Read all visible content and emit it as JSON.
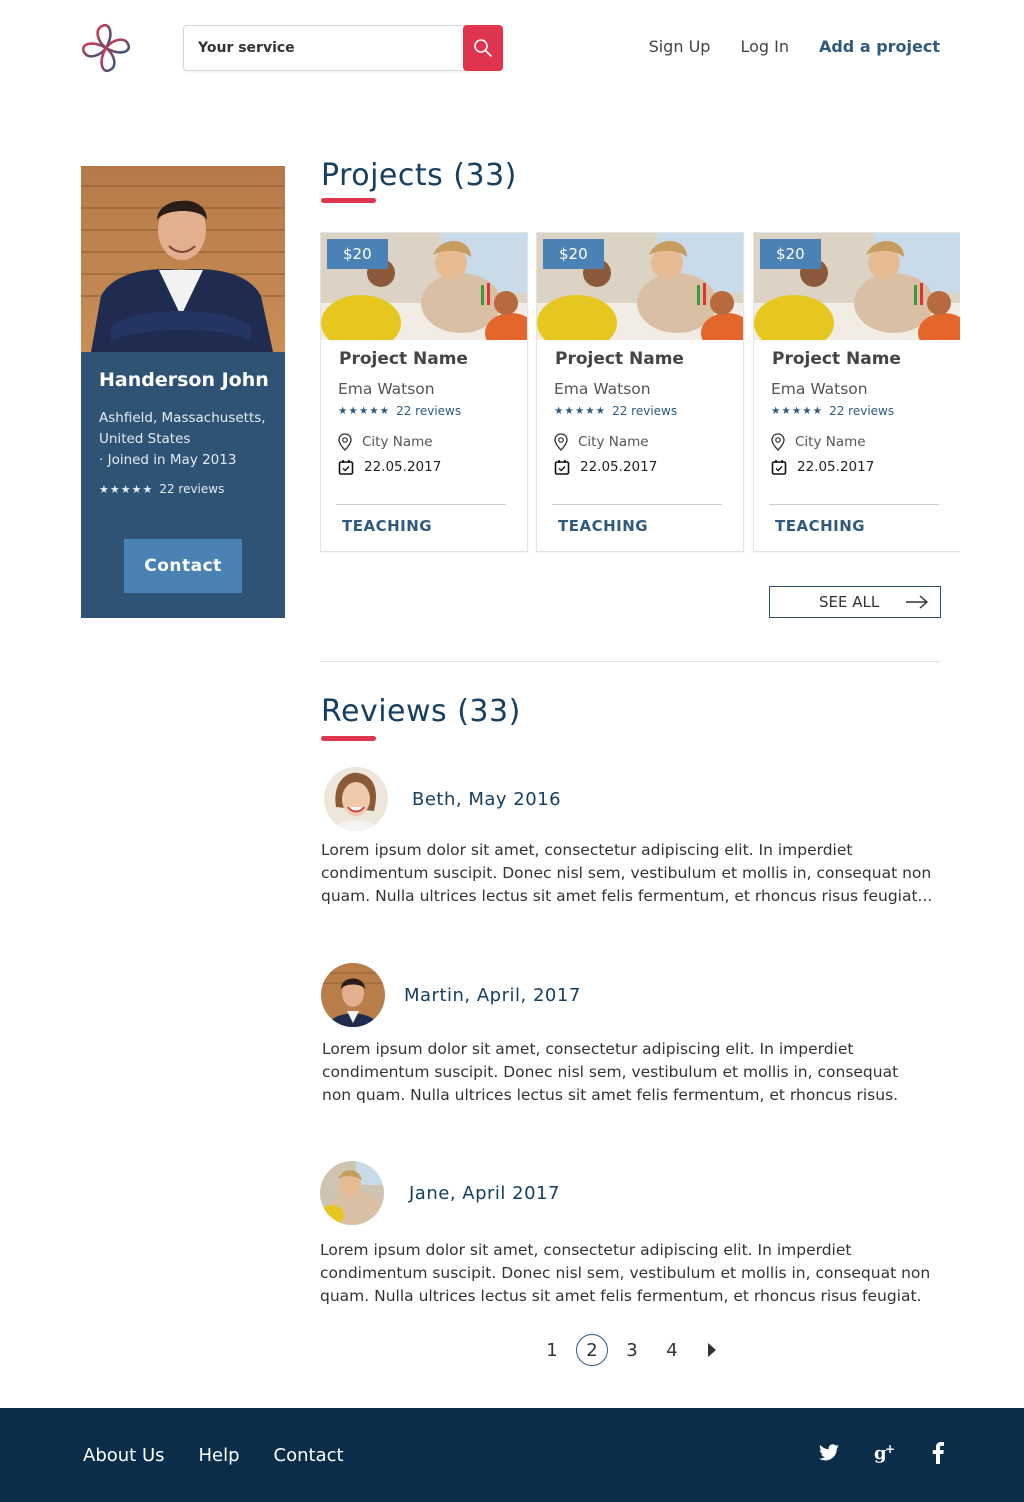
{
  "header": {
    "search_placeholder": "Your service",
    "nav": [
      "Sign Up",
      "Log In",
      "Add a project"
    ]
  },
  "profile": {
    "name": "Handerson John",
    "location": "Ashfield, Massachusetts, United States",
    "joined": "· Joined in May 2013",
    "stars": "★★★★★",
    "reviews": "22 reviews",
    "contact_label": "Contact"
  },
  "projects": {
    "title": "Projects (33)",
    "cards": [
      {
        "price": "$20",
        "title": "Project Name",
        "author": "Ema Watson",
        "stars": "★★★★★",
        "reviews": "22 reviews",
        "city": "City Name",
        "date": "22.05.2017",
        "category": "TEACHING"
      },
      {
        "price": "$20",
        "title": "Project Name",
        "author": "Ema Watson",
        "stars": "★★★★★",
        "reviews": "22 reviews",
        "city": "City Name",
        "date": "22.05.2017",
        "category": "TEACHING"
      },
      {
        "price": "$20",
        "title": "Project Name",
        "author": "Ema Watson",
        "stars": "★★★★★",
        "reviews": "22 reviews",
        "city": "City Name",
        "date": "22.05.2017",
        "category": "TEACHING"
      }
    ],
    "see_all": "SEE ALL"
  },
  "reviews": {
    "title": "Reviews (33)",
    "items": [
      {
        "author": "Beth, May 2016",
        "text": "Lorem ipsum dolor sit amet, consectetur adipiscing elit. In imperdiet condimentum suscipit. Donec nisl sem, vestibulum et mollis in, consequat non quam. Nulla ultrices lectus sit amet felis fermentum, et rhoncus risus feugiat..."
      },
      {
        "author": "Martin, April, 2017",
        "text": "Lorem ipsum dolor sit amet, consectetur adipiscing elit. In imperdiet condimentum suscipit. Donec nisl sem, vestibulum et mollis in, consequat non quam. Nulla ultrices lectus sit amet felis fermentum, et rhoncus risus."
      },
      {
        "author": "Jane,  April  2017",
        "text": "Lorem ipsum dolor sit amet, consectetur adipiscing elit. In imperdiet condimentum suscipit. Donec nisl sem, vestibulum et mollis in, consequat non quam. Nulla ultrices lectus sit amet felis fermentum, et rhoncus risus feugiat."
      }
    ]
  },
  "pagination": {
    "pages": [
      "1",
      "2",
      "3",
      "4"
    ],
    "current": "2",
    "next_icon": "caret-right-icon"
  },
  "footer": {
    "links": [
      "About Us",
      "Help",
      "Contact"
    ],
    "social_icons": [
      "twitter-icon",
      "google-plus-icon",
      "facebook-icon"
    ]
  },
  "colors": {
    "accent": "#e0354f",
    "primary": "#2f5374",
    "button": "#4b82b5",
    "footer": "#0a2e4a"
  }
}
